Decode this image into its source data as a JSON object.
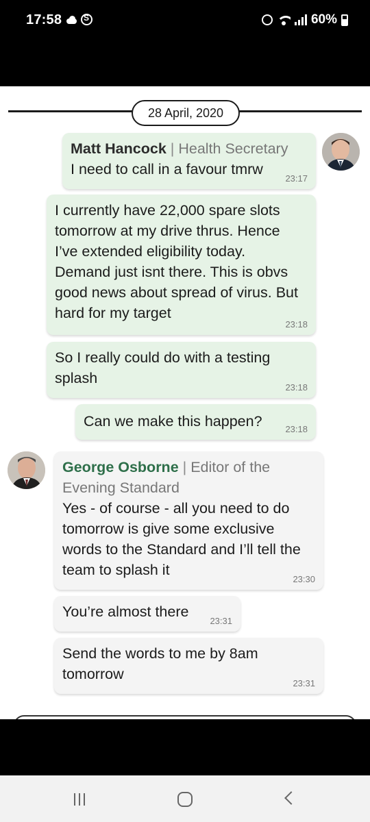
{
  "status_bar": {
    "time": "17:58",
    "battery": "60%"
  },
  "chat": {
    "date": "28 April, 2020",
    "messages": [
      {
        "sender_name": "Matt Hancock",
        "sender_sep": " | ",
        "sender_role": "Health Secretary",
        "text": "I need to call in a favour tmrw",
        "time": "23:17",
        "side": "right"
      },
      {
        "text": "I currently have 22,000 spare slots tomorrow at my drive thrus. Hence I’ve extended eligibility today. Demand just isnt there. This is obvs good news about spread of virus. But hard for my target",
        "time": "23:18",
        "side": "right"
      },
      {
        "text": "So I really could do with a testing splash",
        "time": "23:18",
        "side": "right"
      },
      {
        "text": "Can we make this happen?",
        "time": "23:18",
        "side": "right"
      },
      {
        "sender_name": "George Osborne",
        "sender_sep": " | ",
        "sender_role": "Editor of the Evening Standard",
        "text": "Yes - of course - all you need to do tomorrow is give some exclusive words to the Standard and I’ll tell the team to splash it",
        "time": "23:30",
        "side": "left"
      },
      {
        "text": "You’re almost there",
        "time": "23:31",
        "side": "left"
      },
      {
        "text": "Send the words to me by 8am tomorrow",
        "time": "23:31",
        "side": "left"
      }
    ]
  },
  "colors": {
    "outgoing_bubble": "#e6f3e6",
    "incoming_bubble": "#f4f4f4",
    "osborne_name": "#2e6f4a"
  }
}
